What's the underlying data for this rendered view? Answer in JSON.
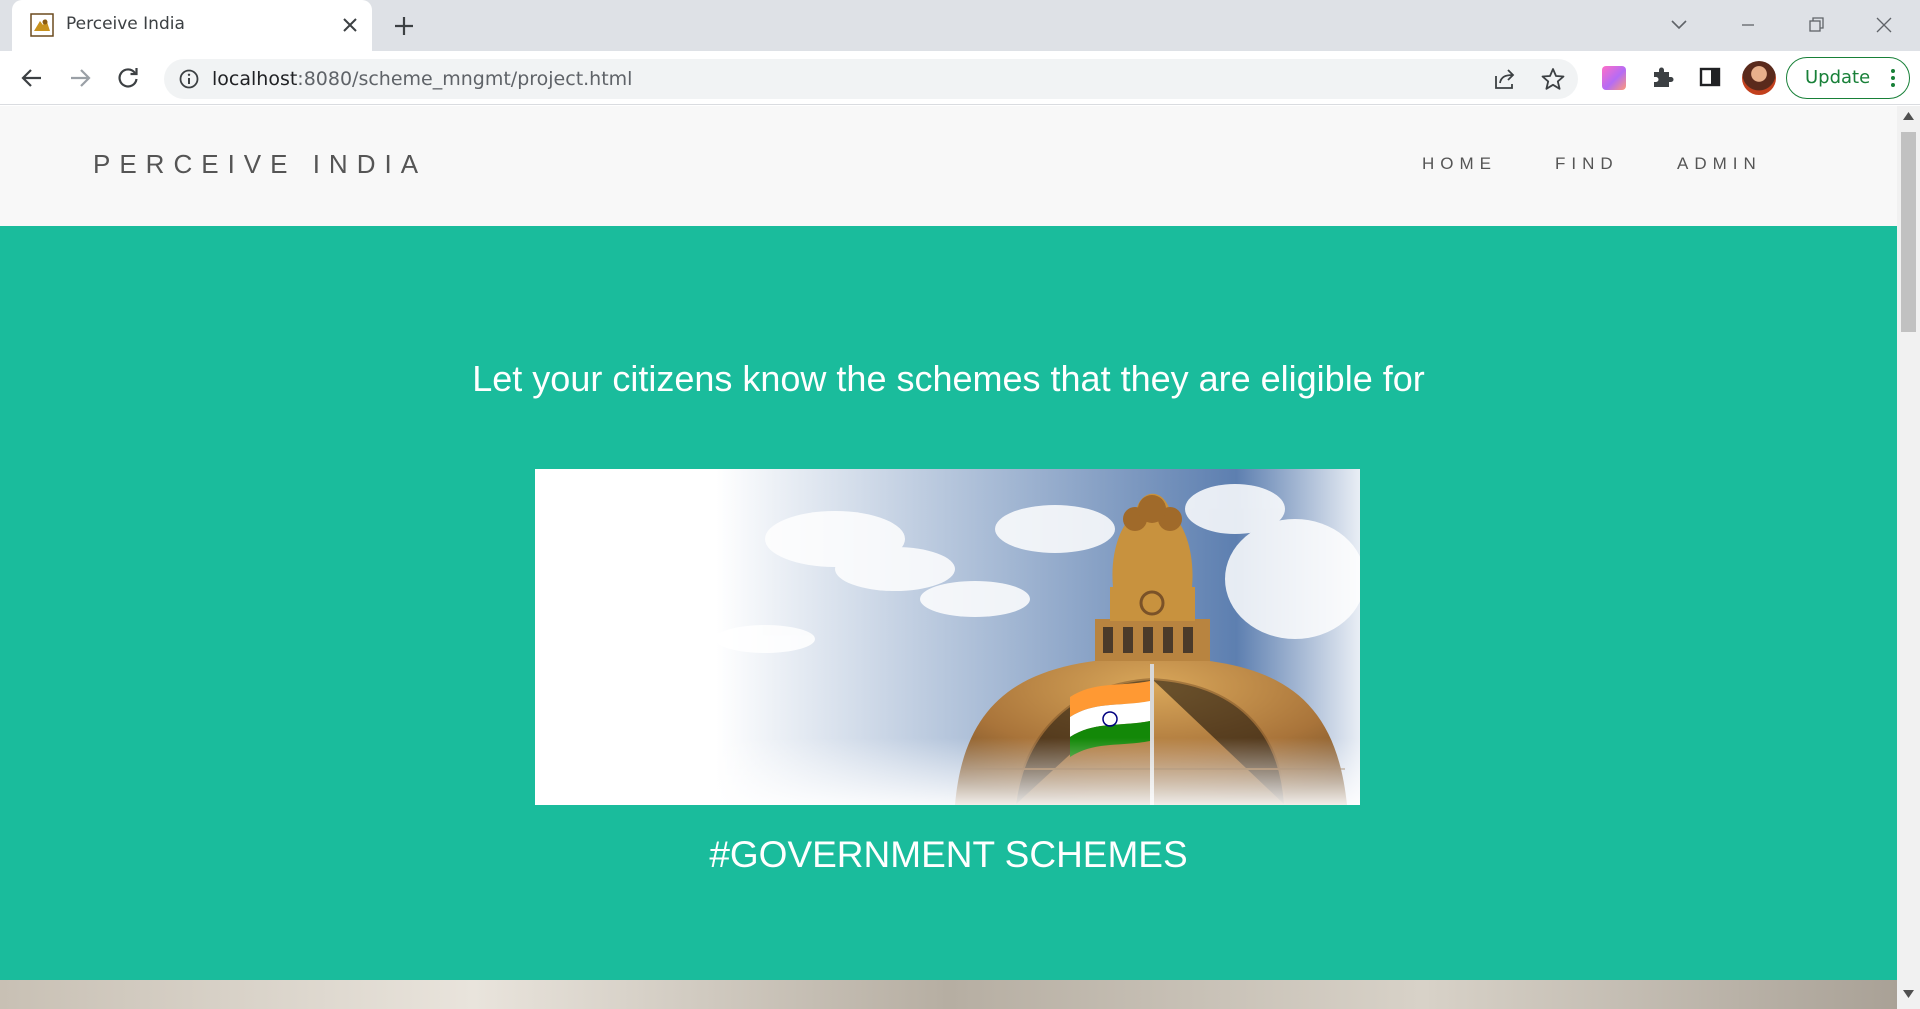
{
  "browser": {
    "tab_title": "Perceive India",
    "url_host": "localhost",
    "url_rest": ":8080/scheme_mngmt/project.html",
    "update_label": "Update",
    "update_color": "#188038"
  },
  "page": {
    "brand": "PERCEIVE INDIA",
    "nav": {
      "home": "HOME",
      "find": "FIND",
      "admin": "ADMIN"
    },
    "hero": {
      "tagline": "Let your citizens know the schemes that they are eligible for",
      "hashtag": "#GOVERNMENT SCHEMES",
      "background_color": "#1abc9c"
    },
    "navbar_color": "#f8f8f8",
    "text_color": "#555555"
  },
  "icons": {
    "favicon": "emblem-favicon-icon",
    "tab_close": "close-icon",
    "new_tab": "plus-icon",
    "back": "arrow-left-icon",
    "forward": "arrow-right-icon",
    "reload": "reload-icon",
    "site_info": "info-icon",
    "share": "share-icon",
    "bookmark": "star-icon",
    "extensions": "puzzle-icon",
    "side_panel": "side-panel-icon",
    "menu": "kebab-menu-icon"
  }
}
